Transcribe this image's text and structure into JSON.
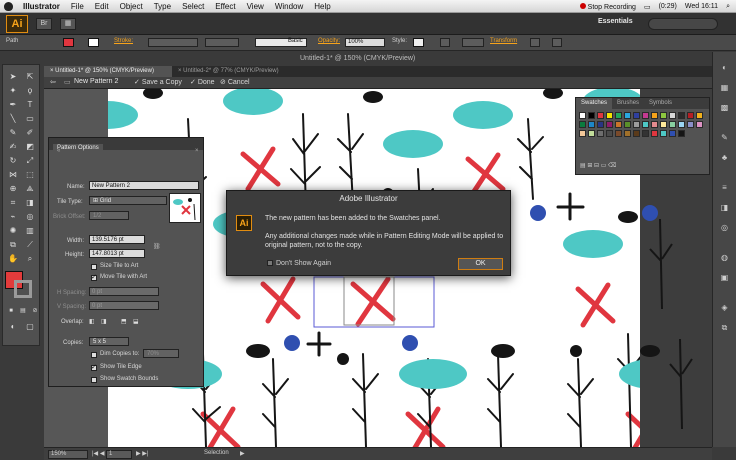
{
  "menubar": {
    "app_name": "Illustrator",
    "items": [
      "File",
      "Edit",
      "Object",
      "Type",
      "Select",
      "Effect",
      "View",
      "Window",
      "Help"
    ],
    "stop_recording": "Stop Recording",
    "timer": "(0:29)",
    "clock": "Wed 16:11"
  },
  "appbar": {
    "logo": "Ai",
    "workspace": "Essentials"
  },
  "controlbar": {
    "selection_label": "Path",
    "stroke_label": "Stroke:",
    "brush_label": "Basic",
    "opacity_label": "Opacity:",
    "opacity_value": "100%",
    "style_label": "Style:",
    "transform_label": "Transform"
  },
  "document": {
    "window_title": "Untitled-1* @ 150% (CMYK/Preview)",
    "tabs": [
      {
        "label": "Untitled-1* @ 150% (CMYK/Preview)"
      },
      {
        "label": "Untitled-2* @ 77% (CMYK/Preview)"
      }
    ]
  },
  "isolation": {
    "pattern_name": "New Pattern 2",
    "save_copy": "Save a Copy",
    "done": "Done",
    "cancel": "Cancel"
  },
  "swatches_panel": {
    "tabs": [
      "Swatches",
      "Brushes",
      "Symbols"
    ]
  },
  "pattern_options": {
    "title": "Pattern Options",
    "name_label": "Name:",
    "name_value": "New Pattern 2",
    "tile_type_label": "Tile Type:",
    "tile_type_value": "Grid",
    "brick_offset_label": "Brick Offset:",
    "brick_offset_value": "1/2",
    "width_label": "Width:",
    "width_value": "139.5176 pt",
    "height_label": "Height:",
    "height_value": "147.8013 pt",
    "size_tile_label": "Size Tile to Art",
    "move_tile_label": "Move Tile with Art",
    "h_spacing_label": "H Spacing:",
    "h_spacing_value": "0 pt",
    "v_spacing_label": "V Spacing:",
    "v_spacing_value": "0 pt",
    "overlap_label": "Overlap:",
    "copies_label": "Copies:",
    "copies_value": "5 x 5",
    "dim_copies_label": "Dim Copies to:",
    "dim_copies_value": "70%",
    "show_tile_edge_label": "Show Tile Edge",
    "show_swatch_bounds_label": "Show Swatch Bounds"
  },
  "dialog": {
    "title": "Adobe Illustrator",
    "icon": "Ai",
    "message_1": "The new pattern has been added to the Swatches panel.",
    "message_2": "Any additional changes made while in Pattern Editing Mode will be applied to original pattern, not to the copy.",
    "dont_show": "Don't Show Again",
    "ok": "OK"
  },
  "statusbar": {
    "zoom": "150%",
    "page": "1",
    "tool": "Selection"
  },
  "colors": {
    "teal": "#4ec8c5",
    "red": "#e0363f",
    "blue": "#2f4fb0",
    "black": "#151515",
    "accent": "#f7a31a"
  }
}
